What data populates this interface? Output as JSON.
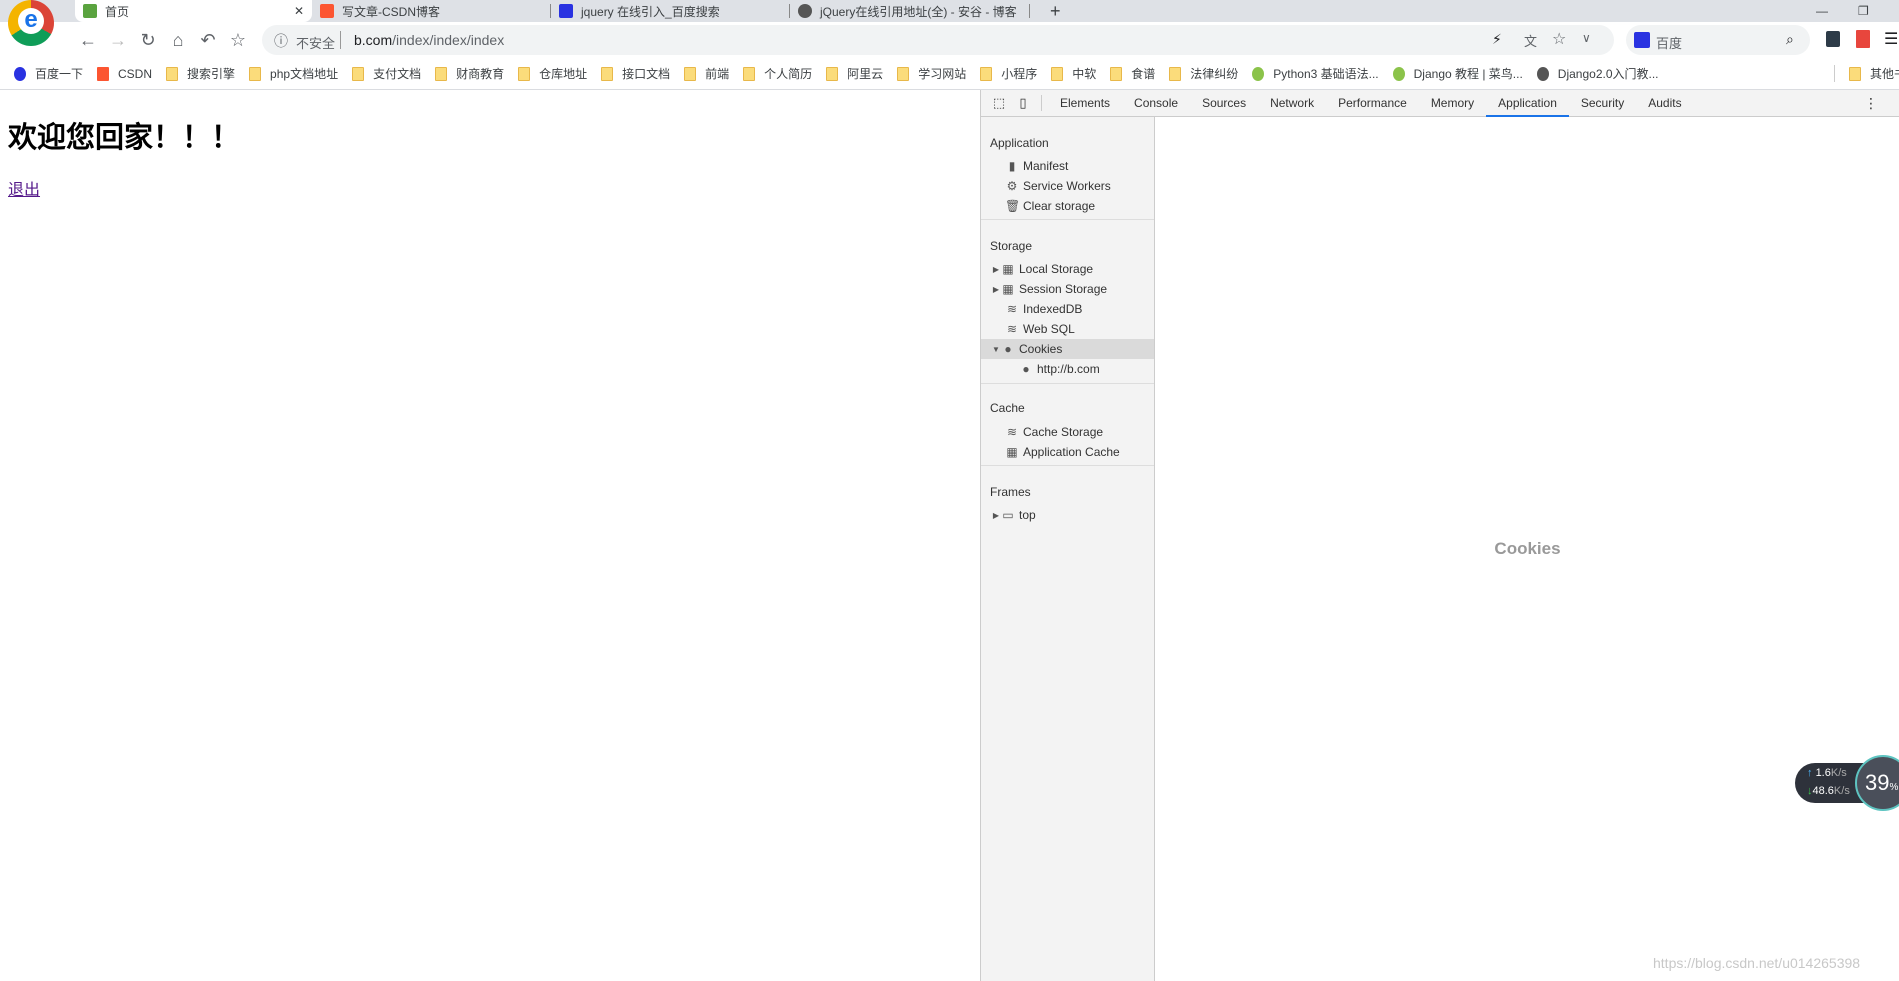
{
  "browser": {
    "tabs": [
      {
        "title": "首页",
        "active": true,
        "icon": "leaf-favicon",
        "color": "#5aa33f"
      },
      {
        "title": "写文章-CSDN博客",
        "icon": "csdn-favicon",
        "color": "#fc5531"
      },
      {
        "title": "jquery 在线引入_百度搜索",
        "icon": "baidu-paw-favicon",
        "color": "#2932e1"
      },
      {
        "title": "jQuery在线引用地址(全) - 安谷 - 博客",
        "icon": "globe-favicon",
        "color": "#555555"
      }
    ],
    "new_tab": "+",
    "security_label": "不安全",
    "url_host": "b.com",
    "url_path": "/index/index/index",
    "search_engine": "百度",
    "bookmarks": [
      "百度一下",
      "CSDN",
      "搜索引擎",
      "php文档地址",
      "支付文档",
      "财商教育",
      "仓库地址",
      "接口文档",
      "前端",
      "个人简历",
      "阿里云",
      "学习网站",
      "小程序",
      "中软",
      "食谱",
      "法律纠纷",
      "Python3 基础语法...",
      "Django 教程 | 菜鸟...",
      "Django2.0入门教..."
    ],
    "other_bookmarks": "其他书签"
  },
  "page": {
    "heading": "欢迎您回家！！！",
    "logout_link": "退出"
  },
  "devtools": {
    "tabs": [
      "Elements",
      "Console",
      "Sources",
      "Network",
      "Performance",
      "Memory",
      "Application",
      "Security",
      "Audits"
    ],
    "active_tab": "Application",
    "sidebar": {
      "application": {
        "header": "Application",
        "items": [
          "Manifest",
          "Service Workers",
          "Clear storage"
        ]
      },
      "storage": {
        "header": "Storage",
        "items": [
          "Local Storage",
          "Session Storage",
          "IndexedDB",
          "Web SQL",
          "Cookies",
          "http://b.com"
        ]
      },
      "cache": {
        "header": "Cache",
        "items": [
          "Cache Storage",
          "Application Cache"
        ]
      },
      "frames": {
        "header": "Frames",
        "items": [
          "top"
        ]
      }
    },
    "selected": "Cookies",
    "main_placeholder": "Cookies"
  },
  "net_widget": {
    "upload": "1.6",
    "download": "48.6",
    "unit": "K/s",
    "cpu": "39",
    "cpu_unit": "%"
  },
  "watermark": "https://blog.csdn.net/u014265398"
}
